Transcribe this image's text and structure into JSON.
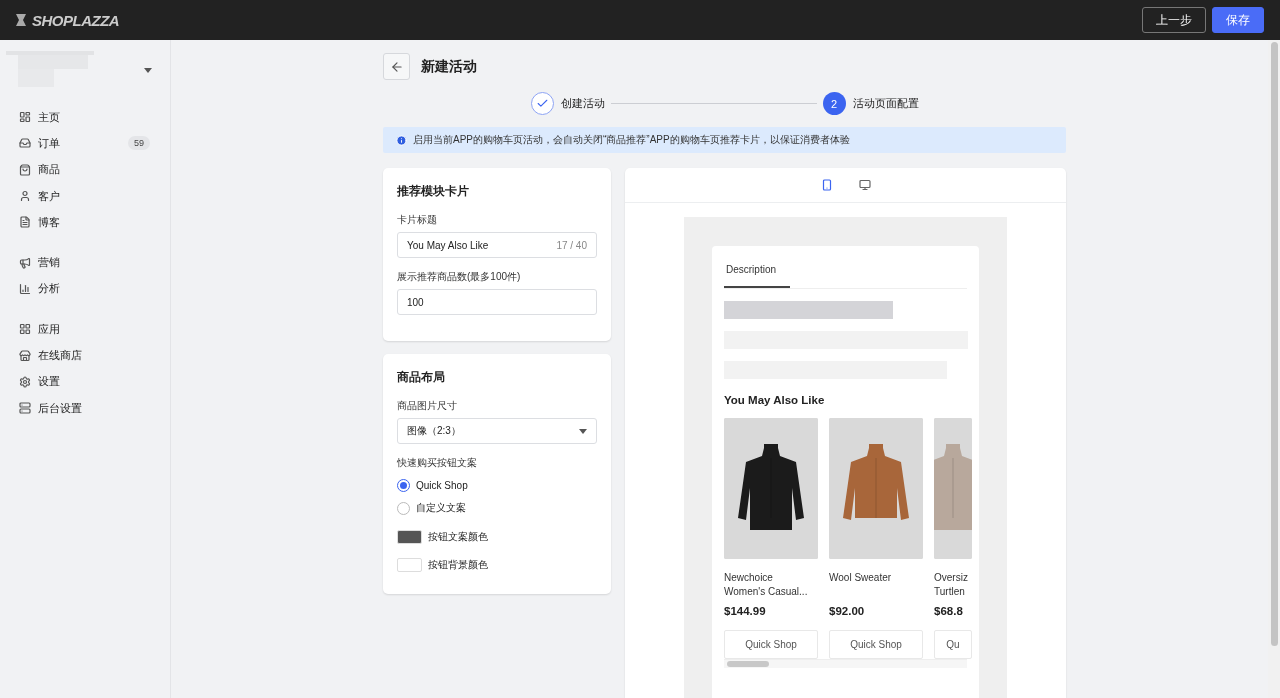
{
  "topbar": {
    "logo": "SHOPLAZZA",
    "buttons": [
      {
        "label": "上一步",
        "kind": "secondary"
      },
      {
        "label": "保存",
        "kind": "primary"
      }
    ]
  },
  "sidebar": {
    "groups": [
      {
        "items": [
          {
            "label": "主页"
          },
          {
            "label": "订单",
            "badge": "59"
          },
          {
            "label": "商品"
          },
          {
            "label": "客户"
          },
          {
            "label": "博客"
          }
        ]
      },
      {
        "items": [
          {
            "label": "营销"
          },
          {
            "label": "分析"
          }
        ]
      },
      {
        "items": [
          {
            "label": "应用"
          },
          {
            "label": "在线商店"
          },
          {
            "label": "设置"
          },
          {
            "label": "后台设置"
          }
        ]
      }
    ]
  },
  "page": {
    "title": "新建活动"
  },
  "steps": [
    {
      "label": "创建活动",
      "done": true
    },
    {
      "number": "2",
      "label": "活动页面配置",
      "done": false
    }
  ],
  "alert": {
    "text": "启用当前APP的购物车页活动，会自动关闭“商品推荐”APP的购物车页推荐卡片，以保证消费者体验"
  },
  "card_settings": {
    "title": "推荐模块卡片",
    "fields": [
      {
        "label": "卡片标题",
        "value": "You May Also Like",
        "counter": "17 / 40"
      },
      {
        "label": "展示推荐商品数(最多100件)",
        "value": "100"
      }
    ]
  },
  "layout_settings": {
    "title": "商品布局",
    "select": {
      "label": "商品图片尺寸",
      "value": "图像（2:3）"
    },
    "radio": {
      "label": "快速购买按钮文案",
      "options": [
        {
          "label": "Quick Shop",
          "selected": true
        },
        {
          "label": "自定义文案",
          "selected": false
        }
      ]
    },
    "colors": [
      {
        "label": "按钮文案颜色",
        "color": "#555555"
      },
      {
        "label": "按钮背景颜色",
        "color": "#ffffff"
      }
    ]
  },
  "preview": {
    "devices": [
      {
        "kind": "mobile",
        "selected": true
      },
      {
        "kind": "desktop",
        "selected": false
      }
    ],
    "tab": "Description",
    "heading": "You May Also Like",
    "products": [
      {
        "name_lines": [
          "Newchoice",
          "Women's Casual..."
        ],
        "price": "$144.99",
        "button": "Quick Shop"
      },
      {
        "name_lines": [
          "Wool Sweater"
        ],
        "price": "$92.00",
        "button": "Quick Shop"
      },
      {
        "name_lines": [
          "Oversiz",
          "Turtlen"
        ],
        "price": "$68.8",
        "button": "Qu"
      }
    ]
  }
}
